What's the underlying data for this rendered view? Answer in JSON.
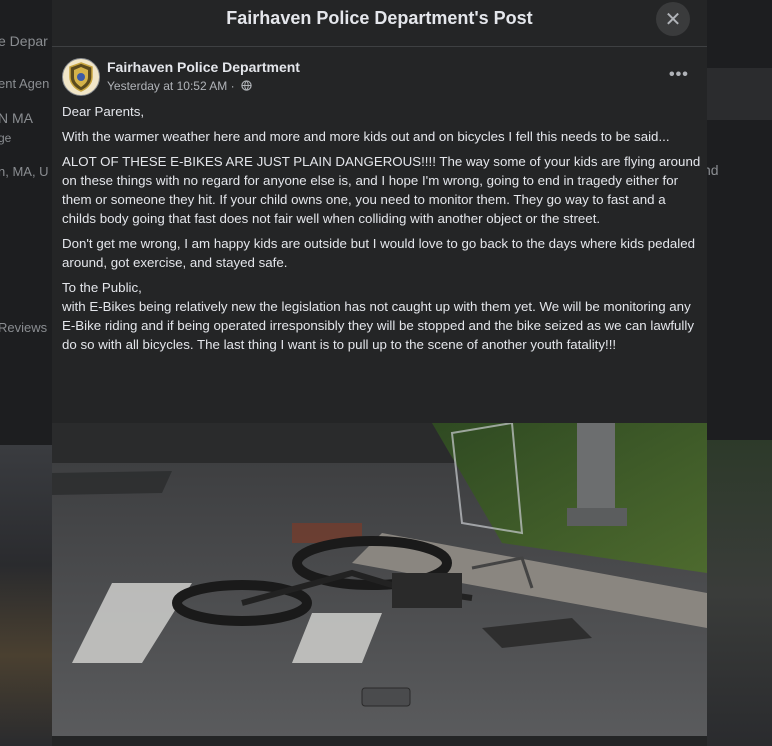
{
  "background": {
    "left_texts": [
      "e Depar",
      "ent Agen",
      "N MA",
      "ge",
      "n, MA, U",
      "Reviews"
    ],
    "right_text": "nd"
  },
  "modal": {
    "title": "Fairhaven Police Department's Post",
    "close_icon": "close-icon"
  },
  "post": {
    "author": "Fairhaven Police Department",
    "timestamp": "Yesterday at 10:52 AM",
    "separator": "·",
    "audience_icon": "globe-icon",
    "more_icon": "more-options-icon",
    "more_label": "•••",
    "paragraphs": [
      "Dear Parents,",
      "With the warmer weather here and more and more kids out and on bicycles I fell this needs to be said...",
      "ALOT OF THESE E-BIKES ARE JUST PLAIN DANGEROUS!!!! The way some of your kids are flying around on these things with no regard for anyone else is, and I hope I'm wrong, going to end in tragedy either for them or someone they hit. If your child owns one, you need to monitor them. They go way to fast and a childs body going that fast does not fair well when colliding with another object or the street.",
      "Don't get me wrong, I am happy kids are outside but I would love to go back to the days where kids pedaled around, got exercise, and stayed safe.",
      "To the Public,\nwith E-Bikes being relatively new the legislation has not caught up with them yet. We will be monitoring any E-Bike riding and if being operated irresponsibly they will be stopped and the bike seized as we can lawfully do so with all bicycles. The last thing I want is to pull up to the scene of another youth fatality!!!"
    ]
  },
  "colors": {
    "modal_bg": "#242526",
    "text_primary": "#e4e6eb",
    "text_secondary": "#b0b3b8"
  }
}
